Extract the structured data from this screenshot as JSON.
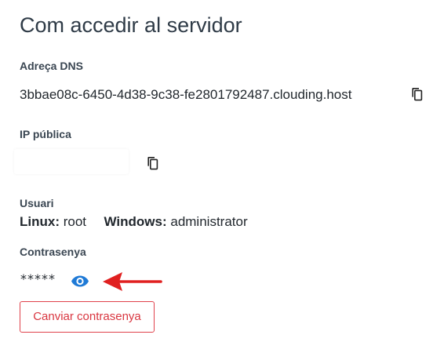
{
  "title": "Com accedir al servidor",
  "dns": {
    "label": "Adreça DNS",
    "value": "3bbae08c-6450-4d38-9c38-fe2801792487.clouding.host",
    "copy_icon": "copy-icon"
  },
  "ip": {
    "label": "IP pública",
    "value": "",
    "copy_icon": "copy-icon"
  },
  "user": {
    "label": "Usuari",
    "linux_key": "Linux:",
    "linux_value": "root",
    "windows_key": "Windows:",
    "windows_value": "administrator"
  },
  "password": {
    "label": "Contrasenya",
    "masked": "*****",
    "reveal_icon": "eye-icon"
  },
  "annotation": {
    "icon": "arrow-left-icon",
    "color": "#e02020"
  },
  "change_password_button": "Canviar contrasenya",
  "colors": {
    "accent_blue": "#1f7ad6",
    "danger": "#e0414b"
  }
}
